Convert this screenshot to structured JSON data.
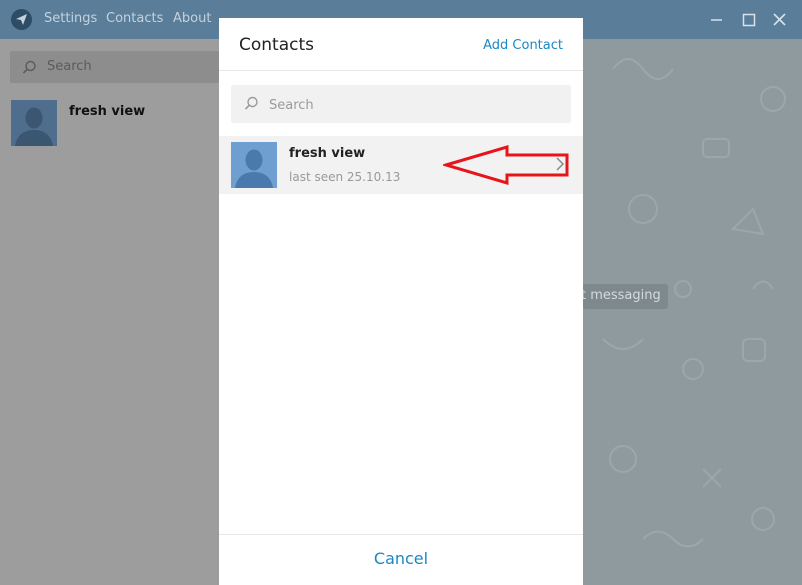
{
  "menu": {
    "settings": "Settings",
    "contacts": "Contacts",
    "about": "About"
  },
  "left": {
    "search_placeholder": "Search",
    "chat_name": "fresh view"
  },
  "right": {
    "empty_text": "t messaging"
  },
  "modal": {
    "title": "Contacts",
    "add_contact": "Add Contact",
    "search_placeholder": "Search",
    "contacts": [
      {
        "name": "fresh view",
        "status": "last seen 25.10.13"
      }
    ],
    "cancel": "Cancel"
  },
  "colors": {
    "accent": "#1b87c4",
    "annotation_arrow": "#e8141b",
    "titlebar": "#5a7d99"
  }
}
